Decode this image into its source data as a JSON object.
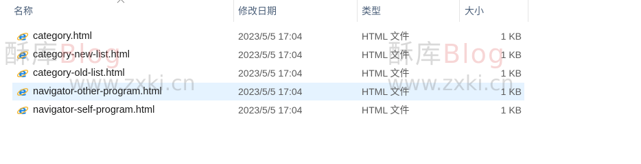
{
  "header": {
    "name_label": "名称",
    "date_label": "修改日期",
    "type_label": "类型",
    "size_label": "大小"
  },
  "files": [
    {
      "name": "category.html",
      "modified": "2023/5/5 17:04",
      "type": "HTML 文件",
      "size": "1 KB",
      "selected": false
    },
    {
      "name": "category-new-list.html",
      "modified": "2023/5/5 17:04",
      "type": "HTML 文件",
      "size": "1 KB",
      "selected": false
    },
    {
      "name": "category-old-list.html",
      "modified": "2023/5/5 17:04",
      "type": "HTML 文件",
      "size": "1 KB",
      "selected": false
    },
    {
      "name": "navigator-other-program.html",
      "modified": "2023/5/5 17:04",
      "type": "HTML 文件",
      "size": "1 KB",
      "selected": true
    },
    {
      "name": "navigator-self-program.html",
      "modified": "2023/5/5 17:04",
      "type": "HTML 文件",
      "size": "1 KB",
      "selected": false
    }
  ],
  "watermark": {
    "site_cn": "酥库",
    "site_blog": "Blog",
    "url": "www.zxki.cn"
  },
  "icons": {
    "file_icon": "internet-explorer-icon",
    "sort_icon": "sort-ascending-chevron-icon"
  },
  "colors": {
    "selected_row": "#e5f3ff",
    "header_text": "#4c607a",
    "ie_blue": "#1e88e5",
    "ie_ring": "#f2b632"
  }
}
